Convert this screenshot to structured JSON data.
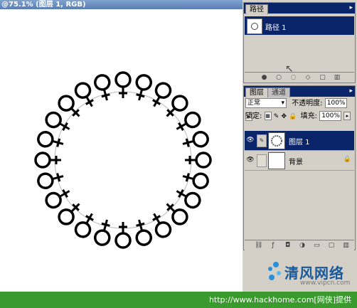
{
  "document": {
    "title": "@75.1% (图层 1, RGB)"
  },
  "paths_panel": {
    "tab": "路径",
    "path_item": "路径 1",
    "footer_icons": [
      "fill-path-icon",
      "stroke-path-icon",
      "load-selection-icon",
      "make-workpath-icon",
      "new-path-icon",
      "delete-path-icon"
    ]
  },
  "layers_panel": {
    "tabs": [
      "图层",
      "通道"
    ],
    "blend_mode": "正常",
    "opacity_label": "不透明度:",
    "opacity_value": "100%",
    "lock_label": "锁定:",
    "fill_label": "填充:",
    "fill_value": "100%",
    "layers": [
      {
        "name": "图层 1",
        "active": true
      },
      {
        "name": "背景",
        "active": false,
        "locked": true
      }
    ]
  },
  "watermark": {
    "brand": "清风网络",
    "url": "www.vipcn.com"
  },
  "footer": {
    "text": "http://www.hackhome.com[网侠]提供"
  }
}
